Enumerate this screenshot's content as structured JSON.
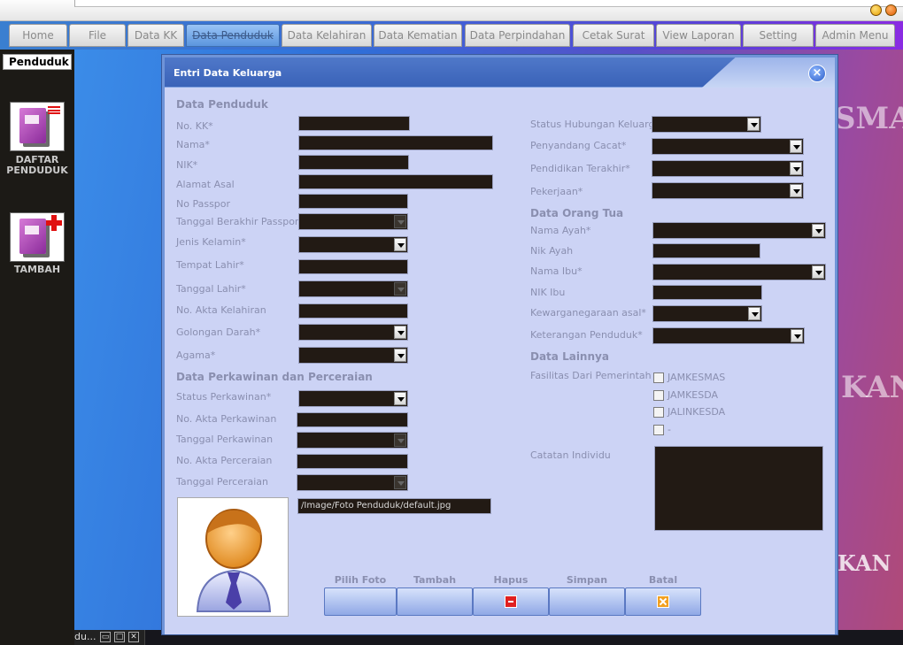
{
  "menubar": {
    "tabs": [
      {
        "label": "Home"
      },
      {
        "label": "File"
      },
      {
        "label": "Data KK"
      },
      {
        "label": "Data Penduduk"
      },
      {
        "label": "Data Kelahiran"
      },
      {
        "label": "Data Kematian"
      },
      {
        "label": "Data Perpindahan"
      },
      {
        "label": "Cetak Surat"
      },
      {
        "label": "View Laporan"
      },
      {
        "label": "Setting"
      },
      {
        "label": "Admin Menu"
      }
    ],
    "active_tab": "Data Penduduk"
  },
  "sidebar": {
    "header": "Penduduk",
    "items": [
      {
        "label": "DAFTAR\nPENDUDUK",
        "icon": "book-list-icon"
      },
      {
        "label": "TAMBAH",
        "icon": "book-add-icon"
      }
    ]
  },
  "background": {
    "text1": "SMAS",
    "text2": "KAN",
    "text3": "KAN"
  },
  "taskbar": {
    "item": "du..."
  },
  "dialog": {
    "title": "Entri Data Keluarga",
    "left": {
      "section_penduduk": "Data Penduduk",
      "fields": {
        "no_kk": "No. KK*",
        "nama": "Nama*",
        "nik": "NIK*",
        "alamat": "Alamat Asal",
        "no_passpor": "No Passpor",
        "tgl_passpor": "Tanggal Berakhir Passpor",
        "jenis_kelamin": "Jenis Kelamin*",
        "tempat_lahir": "Tempat Lahir*",
        "tanggal_lahir": "Tanggal Lahir*",
        "akta_kelahiran": "No. Akta Kelahiran",
        "golongan_darah": "Golongan Darah*",
        "agama": "Agama*"
      },
      "section_perkawinan": "Data Perkawinan dan Perceraian",
      "fields2": {
        "status_perkawinan": "Status Perkawinan*",
        "akta_perkawinan": "No. Akta Perkawinan",
        "tgl_perkawinan": "Tanggal Perkawinan",
        "akta_perceraian": "No. Akta Perceraian",
        "tgl_perceraian": "Tanggal Perceraian"
      },
      "photo_path": "/Image/Foto Penduduk/default.jpg"
    },
    "right": {
      "fields": {
        "status_hubungan": "Status Hubungan Keluarga*",
        "penyandang_cacat": "Penyandang Cacat*",
        "pendidikan": "Pendidikan Terakhir*",
        "pekerjaan": "Pekerjaan*"
      },
      "section_orangtua": "Data Orang Tua",
      "fields2": {
        "nama_ayah": "Nama Ayah*",
        "nik_ayah": "Nik Ayah",
        "nama_ibu": "Nama Ibu*",
        "nik_ibu": "NIK Ibu",
        "kewarganegaraan": "Kewarganegaraan asal*",
        "keterangan": "Keterangan Penduduk*"
      },
      "section_lainnya": "Data Lainnya",
      "fasilitas_label": "Fasilitas Dari Pemerintah",
      "fasilitas": [
        "JAMKESMAS",
        "JAMKESDA",
        "JALINKESDA",
        "-"
      ],
      "catatan_label": "Catatan Individu"
    },
    "buttons": {
      "pilih_foto": "Pilih Foto",
      "tambah": "Tambah",
      "hapus": "Hapus",
      "simpan": "Simpan",
      "batal": "Batal"
    }
  }
}
